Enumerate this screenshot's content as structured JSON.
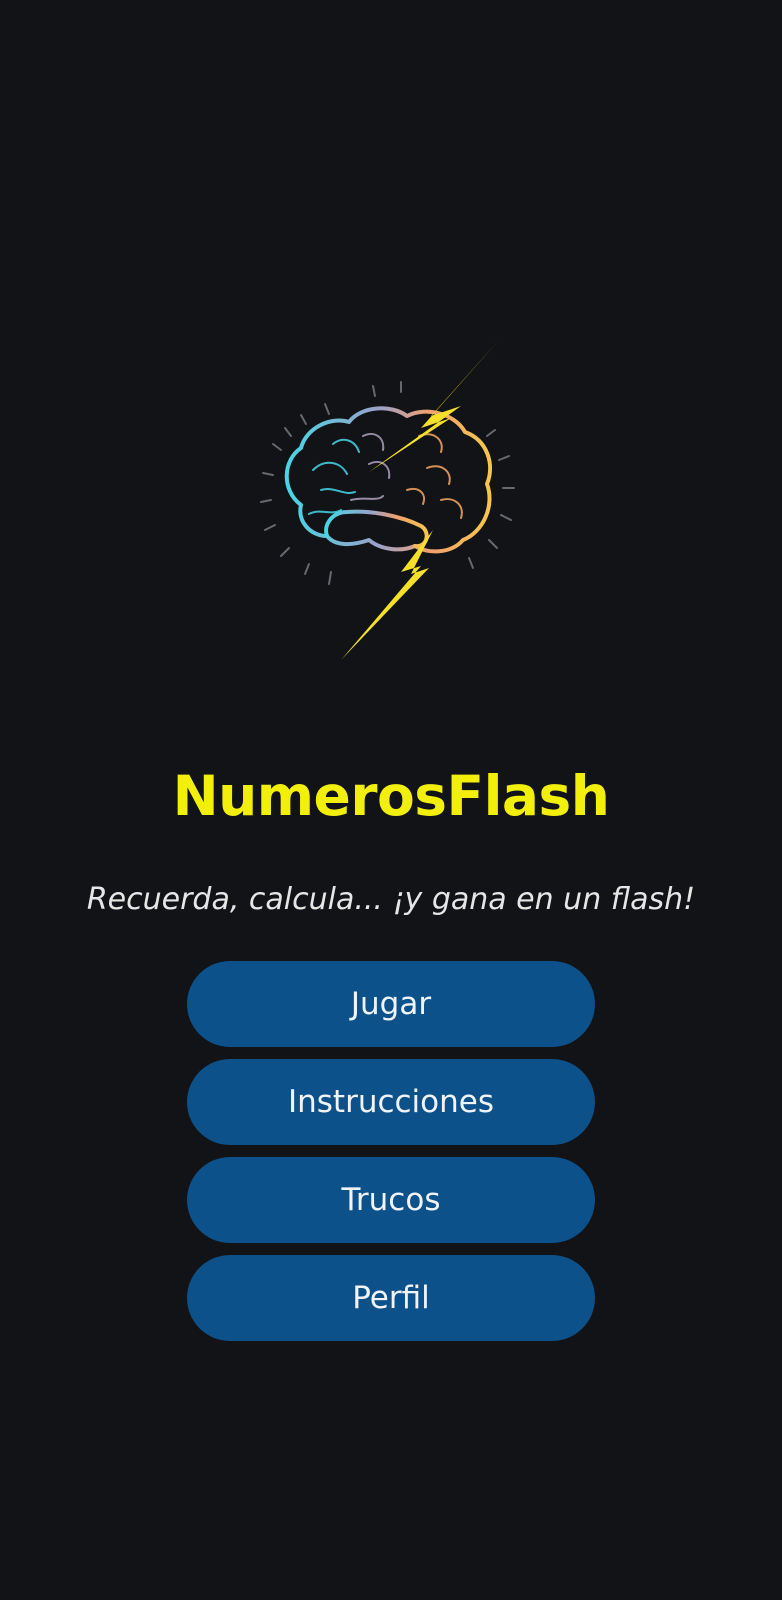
{
  "app": {
    "title": "NumerosFlash",
    "tagline": "Recuerda, calcula... ¡y gana en un flash!",
    "logo": "brain-lightning-icon"
  },
  "menu": {
    "items": [
      {
        "label": "Jugar"
      },
      {
        "label": "Instrucciones"
      },
      {
        "label": "Trucos"
      },
      {
        "label": "Perfil"
      }
    ]
  },
  "colors": {
    "background": "#121316",
    "title": "#f2ef0a",
    "button": "#0d518b",
    "button_text": "#f0f3f7",
    "subtitle": "#e6e6e6"
  }
}
